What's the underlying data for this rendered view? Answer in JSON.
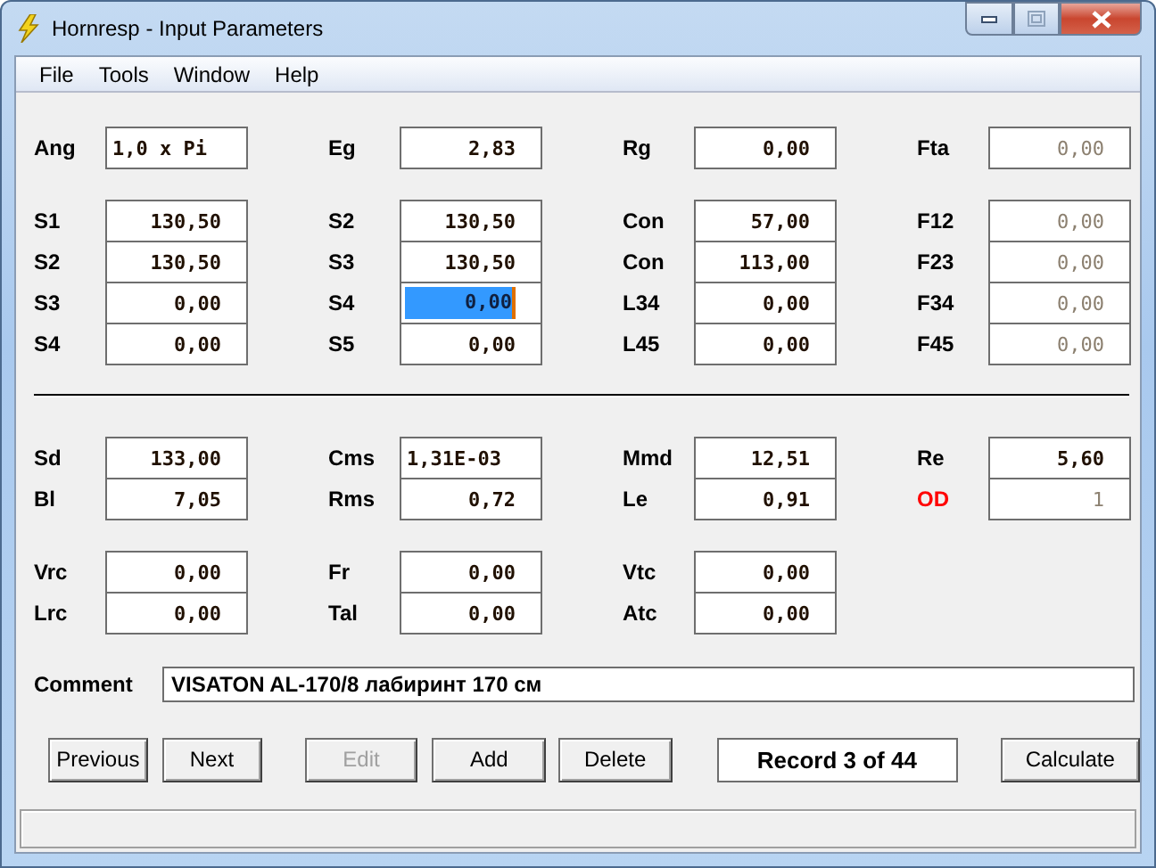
{
  "window": {
    "title": "Hornresp - Input Parameters"
  },
  "menu": [
    {
      "label": "File"
    },
    {
      "label": "Tools"
    },
    {
      "label": "Window"
    },
    {
      "label": "Help"
    }
  ],
  "sections": [
    {
      "groups": [
        [
          [
            {
              "label": "Ang",
              "value": "1,0 x Pi",
              "kind": "text",
              "disabled": false,
              "focused": false,
              "alert": false
            },
            {
              "label": "Eg",
              "value": "2,83",
              "kind": "number",
              "disabled": false,
              "focused": false,
              "alert": false
            },
            {
              "label": "Rg",
              "value": "0,00",
              "kind": "number",
              "disabled": false,
              "focused": false,
              "alert": false
            },
            {
              "label": "Fta",
              "value": "0,00",
              "kind": "number",
              "disabled": true,
              "focused": false,
              "alert": false
            }
          ]
        ],
        [
          [
            {
              "label": "S1",
              "value": "130,50",
              "kind": "number",
              "disabled": false,
              "focused": false,
              "alert": false
            },
            {
              "label": "S2",
              "value": "130,50",
              "kind": "number",
              "disabled": false,
              "focused": false,
              "alert": false
            },
            {
              "label": "Con",
              "value": "57,00",
              "kind": "number",
              "disabled": false,
              "focused": false,
              "alert": false
            },
            {
              "label": "F12",
              "value": "0,00",
              "kind": "number",
              "disabled": true,
              "focused": false,
              "alert": false
            }
          ],
          [
            {
              "label": "S2",
              "value": "130,50",
              "kind": "number",
              "disabled": false,
              "focused": false,
              "alert": false
            },
            {
              "label": "S3",
              "value": "130,50",
              "kind": "number",
              "disabled": false,
              "focused": false,
              "alert": false
            },
            {
              "label": "Con",
              "value": "113,00",
              "kind": "number",
              "disabled": false,
              "focused": false,
              "alert": false
            },
            {
              "label": "F23",
              "value": "0,00",
              "kind": "number",
              "disabled": true,
              "focused": false,
              "alert": false
            }
          ],
          [
            {
              "label": "S3",
              "value": "0,00",
              "kind": "number",
              "disabled": false,
              "focused": false,
              "alert": false
            },
            {
              "label": "S4",
              "value": "0,00",
              "kind": "number",
              "disabled": false,
              "focused": true,
              "alert": false
            },
            {
              "label": "L34",
              "value": "0,00",
              "kind": "number",
              "disabled": false,
              "focused": false,
              "alert": false
            },
            {
              "label": "F34",
              "value": "0,00",
              "kind": "number",
              "disabled": true,
              "focused": false,
              "alert": false
            }
          ],
          [
            {
              "label": "S4",
              "value": "0,00",
              "kind": "number",
              "disabled": false,
              "focused": false,
              "alert": false
            },
            {
              "label": "S5",
              "value": "0,00",
              "kind": "number",
              "disabled": false,
              "focused": false,
              "alert": false
            },
            {
              "label": "L45",
              "value": "0,00",
              "kind": "number",
              "disabled": false,
              "focused": false,
              "alert": false
            },
            {
              "label": "F45",
              "value": "0,00",
              "kind": "number",
              "disabled": true,
              "focused": false,
              "alert": false
            }
          ]
        ]
      ]
    },
    {
      "groups": [
        [
          [
            {
              "label": "Sd",
              "value": "133,00",
              "kind": "number",
              "disabled": false,
              "focused": false,
              "alert": false
            },
            {
              "label": "Cms",
              "value": "1,31E-03",
              "kind": "text",
              "disabled": false,
              "focused": false,
              "alert": false
            },
            {
              "label": "Mmd",
              "value": "12,51",
              "kind": "number",
              "disabled": false,
              "focused": false,
              "alert": false
            },
            {
              "label": "Re",
              "value": "5,60",
              "kind": "number",
              "disabled": false,
              "focused": false,
              "alert": false
            }
          ],
          [
            {
              "label": "Bl",
              "value": "7,05",
              "kind": "number",
              "disabled": false,
              "focused": false,
              "alert": false
            },
            {
              "label": "Rms",
              "value": "0,72",
              "kind": "number",
              "disabled": false,
              "focused": false,
              "alert": false
            },
            {
              "label": "Le",
              "value": "0,91",
              "kind": "number",
              "disabled": false,
              "focused": false,
              "alert": false
            },
            {
              "label": "OD",
              "value": "1",
              "kind": "number",
              "disabled": true,
              "focused": false,
              "alert": true
            }
          ]
        ],
        [
          [
            {
              "label": "Vrc",
              "value": "0,00",
              "kind": "number",
              "disabled": false,
              "focused": false,
              "alert": false
            },
            {
              "label": "Fr",
              "value": "0,00",
              "kind": "number",
              "disabled": false,
              "focused": false,
              "alert": false
            },
            {
              "label": "Vtc",
              "value": "0,00",
              "kind": "number",
              "disabled": false,
              "focused": false,
              "alert": false
            }
          ],
          [
            {
              "label": "Lrc",
              "value": "0,00",
              "kind": "number",
              "disabled": false,
              "focused": false,
              "alert": false
            },
            {
              "label": "Tal",
              "value": "0,00",
              "kind": "number",
              "disabled": false,
              "focused": false,
              "alert": false
            },
            {
              "label": "Atc",
              "value": "0,00",
              "kind": "number",
              "disabled": false,
              "focused": false,
              "alert": false
            }
          ]
        ]
      ]
    }
  ],
  "comment": {
    "label": "Comment",
    "value": "VISATON AL-170/8 лабиринт 170 см"
  },
  "buttons": [
    {
      "label": "Previous",
      "disabled": false,
      "kind": "nav"
    },
    {
      "label": "Next",
      "disabled": false,
      "kind": "nav"
    },
    {
      "label": "Edit",
      "disabled": true,
      "kind": "edit"
    },
    {
      "label": "Add",
      "disabled": false,
      "kind": "edit"
    },
    {
      "label": "Delete",
      "disabled": false,
      "kind": "edit"
    },
    {
      "label": "Record 3 of 44",
      "disabled": false,
      "kind": "record"
    },
    {
      "label": "Calculate",
      "disabled": false,
      "kind": "action"
    }
  ]
}
